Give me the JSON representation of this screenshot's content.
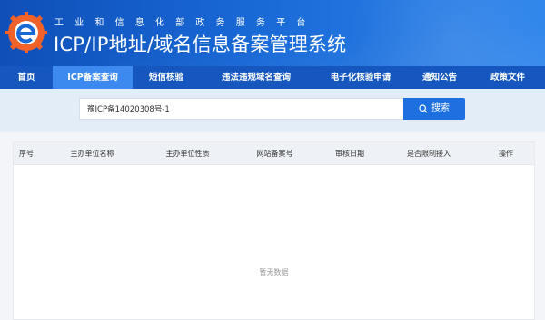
{
  "header": {
    "ministry": "工业和信息化部政务服务平台",
    "title": "ICP/IP地址/域名信息备案管理系统"
  },
  "nav": {
    "items": [
      {
        "label": "首页"
      },
      {
        "label": "ICP备案查询"
      },
      {
        "label": "短信核验"
      },
      {
        "label": "违法违规域名查询"
      },
      {
        "label": "电子化核验申请"
      },
      {
        "label": "通知公告"
      },
      {
        "label": "政策文件"
      }
    ],
    "active_index": 1
  },
  "search": {
    "value": "豫ICP备14020308号-1",
    "button_label": "搜索"
  },
  "table": {
    "columns": [
      "序号",
      "主办单位名称",
      "主办单位性质",
      "网站备案号",
      "审核日期",
      "是否限制接入",
      "操作"
    ],
    "empty_text": "暂无数据"
  },
  "colors": {
    "header_blue": "#1868d6",
    "nav_blue": "#1556bf",
    "nav_active": "#3c8af0",
    "search_button": "#1e6fe0",
    "logo_orange": "#f0622a"
  }
}
